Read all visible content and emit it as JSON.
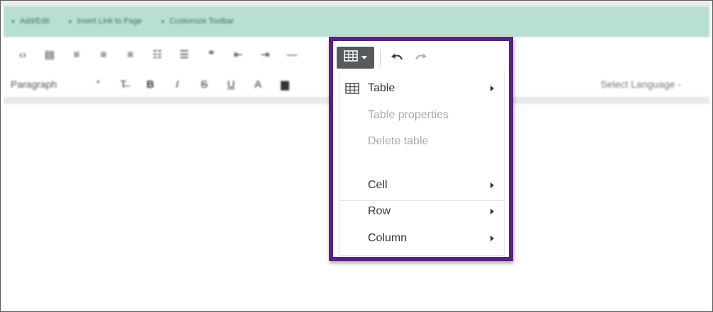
{
  "background_editor": {
    "top_toolbar_items": [
      "Add/Edit",
      "Insert Link to Page",
      "Customize Toolbar"
    ],
    "format_select": "Paragraph",
    "language_select": "Select Language"
  },
  "toolbar": {
    "table_button_icon": "table-icon",
    "undo_icon": "undo-icon",
    "redo_icon": "redo-icon"
  },
  "table_menu": {
    "items": [
      {
        "label": "Table",
        "icon": "table-icon",
        "submenu": true,
        "disabled": false
      },
      {
        "label": "Table properties",
        "submenu": false,
        "disabled": true
      },
      {
        "label": "Delete table",
        "submenu": false,
        "disabled": true
      },
      {
        "label": "Cell",
        "submenu": true,
        "disabled": false
      },
      {
        "label": "Row",
        "submenu": true,
        "disabled": false
      },
      {
        "label": "Column",
        "submenu": true,
        "disabled": false
      }
    ]
  },
  "colors": {
    "highlight_border": "#5b2181",
    "teal_bar": "#b8dfd3",
    "table_button_bg": "#56595e",
    "disabled_text": "#aaaaaa"
  }
}
